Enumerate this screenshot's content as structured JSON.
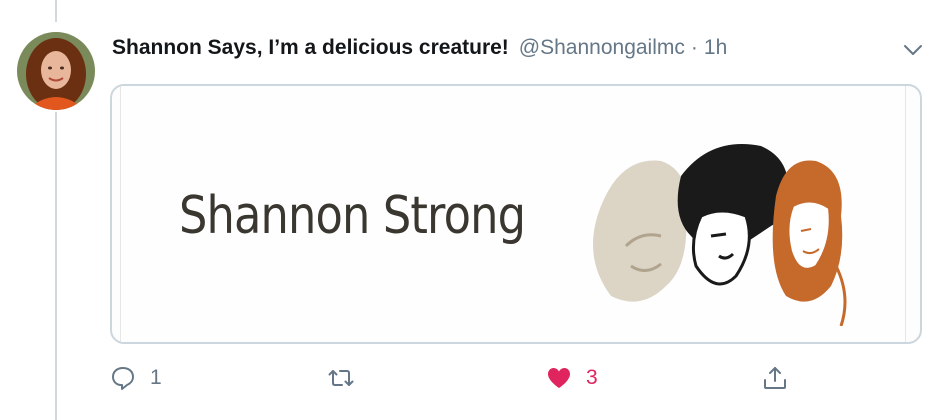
{
  "tweet": {
    "author_name": "Shannon Says, I’m a delicious creature!",
    "handle": "@Shannongailmc",
    "separator": "·",
    "time": "1h",
    "card": {
      "brand_text": "Shannon Strong"
    },
    "actions": {
      "reply_count": "1",
      "retweet_count": "",
      "like_count": "3"
    }
  },
  "colors": {
    "like_active": "#e0245e",
    "muted_text": "#657786",
    "name_text": "#14171a",
    "card_border": "#ccd6dd"
  },
  "icons": {
    "reply": "reply-icon",
    "retweet": "retweet-icon",
    "like": "heart-icon",
    "share": "share-icon",
    "menu": "chevron-down-icon"
  }
}
